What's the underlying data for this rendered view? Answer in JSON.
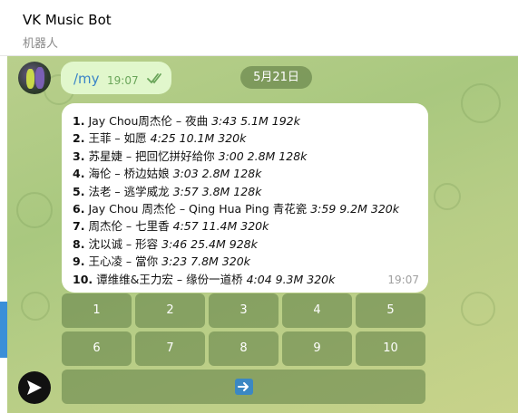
{
  "header": {
    "title": "VK Music Bot",
    "subtitle": "机器人"
  },
  "outgoing": {
    "text": "/my",
    "time": "19:07"
  },
  "date_pill": "5月21日",
  "result": {
    "time": "19:07",
    "tracks": [
      {
        "n": "1.",
        "title": "Jay Chou周杰伦 – 夜曲",
        "meta": "3:43 5.1M 192k"
      },
      {
        "n": "2.",
        "title": "王菲 – 如愿",
        "meta": "4:25 10.1M 320k"
      },
      {
        "n": "3.",
        "title": "苏星婕 – 把回忆拼好给你",
        "meta": "3:00 2.8M 128k"
      },
      {
        "n": "4.",
        "title": "海伦 – 桥边姑娘",
        "meta": "3:03 2.8M 128k"
      },
      {
        "n": "5.",
        "title": "法老 – 逃学威龙",
        "meta": "3:57 3.8M 128k"
      },
      {
        "n": "6.",
        "title": "Jay Chou 周杰伦 – Qing Hua Ping 青花瓷",
        "meta": "3:59 9.2M 320k"
      },
      {
        "n": "7.",
        "title": "周杰伦 – 七里香",
        "meta": "4:57 11.4M 320k"
      },
      {
        "n": "8.",
        "title": "沈以诚 – 形容",
        "meta": "3:46 25.4M 928k"
      },
      {
        "n": "9.",
        "title": "王心凌 – 當你",
        "meta": "3:23 7.8M 320k"
      },
      {
        "n": "10.",
        "title": "谭维维&王力宏 – 缘份一道桥",
        "meta": "4:04 9.3M 320k"
      }
    ]
  },
  "keyboard": {
    "row1": [
      "1",
      "2",
      "3",
      "4",
      "5"
    ],
    "row2": [
      "6",
      "7",
      "8",
      "9",
      "10"
    ],
    "next_icon": "right-arrow-icon"
  },
  "colors": {
    "outgoing_bubble": "#e1f7cc",
    "link_blue": "#3a84c7",
    "check_green": "#6aa55a",
    "chat_bg": "#b9cf8c"
  }
}
